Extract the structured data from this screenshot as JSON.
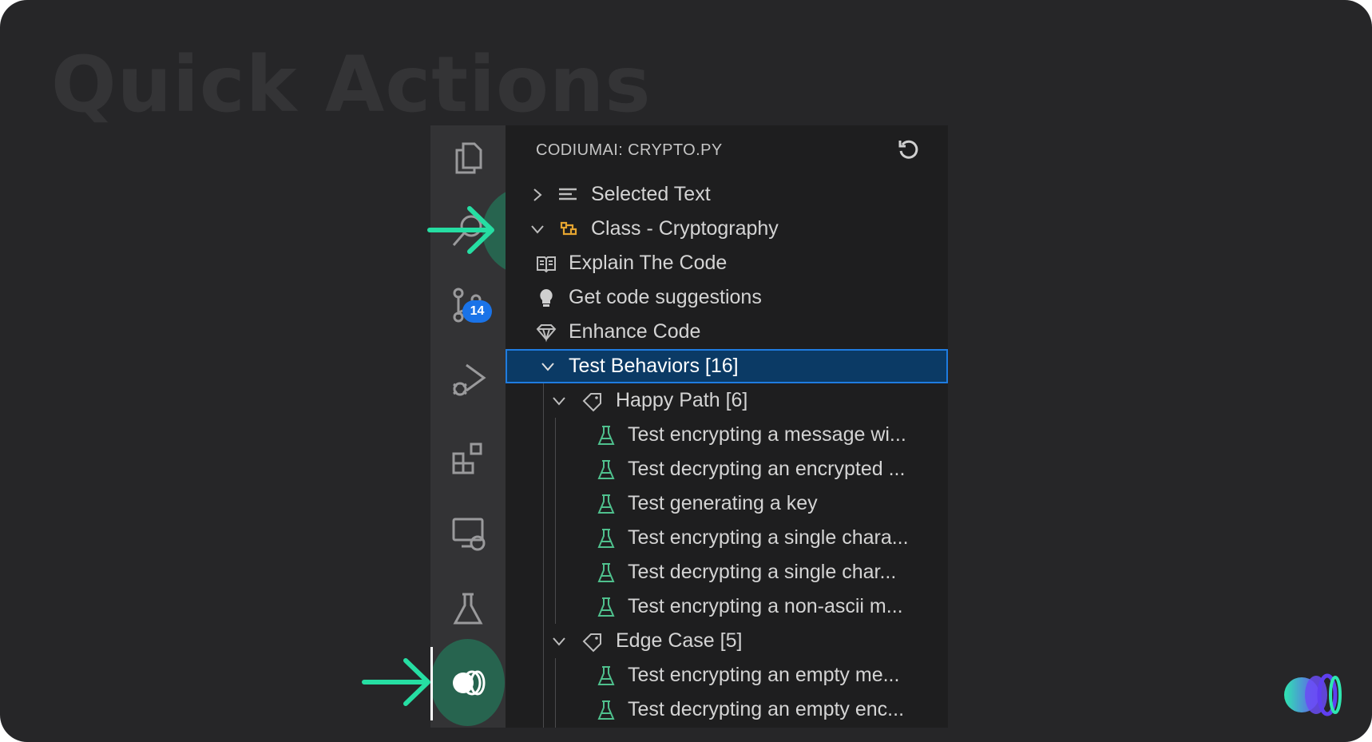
{
  "slide": {
    "title": "Quick Actions"
  },
  "activity_bar": {
    "icons": [
      "explorer-icon",
      "search-icon",
      "source-control-icon",
      "run-debug-icon",
      "extensions-icon",
      "remote-explorer-icon",
      "testing-icon",
      "codiumai-icon"
    ],
    "source_control_badge": "14"
  },
  "panel": {
    "header": "CODIUMAI: CRYPTO.PY",
    "selected_text": "Selected Text",
    "class_label": "Class - Cryptography",
    "actions": {
      "explain": "Explain The Code",
      "suggestions": "Get code suggestions",
      "enhance": "Enhance Code"
    },
    "test_behaviors": "Test Behaviors [16]",
    "happy_path": {
      "label": "Happy Path [6]",
      "tests": [
        "Test encrypting a message wi...",
        "Test decrypting an encrypted ...",
        "Test generating a key",
        "Test encrypting a single chara...",
        "Test decrypting a single char...",
        "Test encrypting a non-ascii m..."
      ]
    },
    "edge_case": {
      "label": "Edge Case [5]",
      "tests": [
        "Test encrypting an empty me...",
        "Test decrypting an empty enc..."
      ]
    }
  },
  "colors": {
    "accent_green": "#26dea3",
    "selection": "#0b3a65",
    "badge_blue": "#1a73e8",
    "test_icon_green": "#4fc08d"
  }
}
